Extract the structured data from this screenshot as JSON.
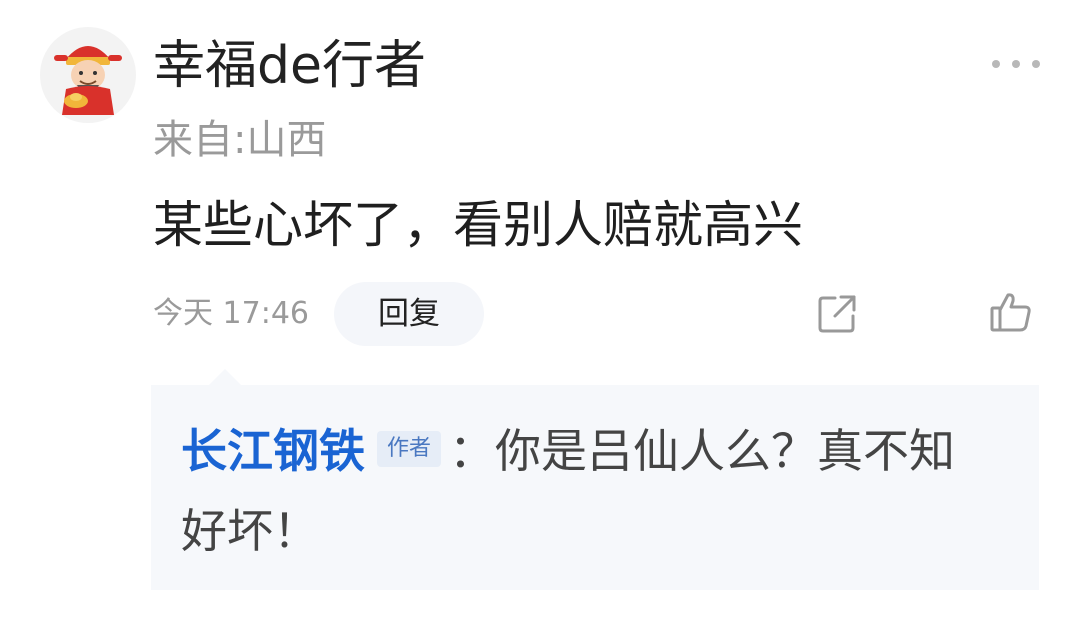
{
  "comment": {
    "avatar_icon": "caishen-avatar-icon",
    "username": "幸福de行者",
    "location": "来自:山西",
    "text": "某些心坏了，看别人赔就高兴",
    "time": "今天 17:46",
    "reply_label": "回复",
    "more_icon": "more-dots-icon",
    "share_icon": "share-icon",
    "like_icon": "thumbs-up-icon"
  },
  "reply": {
    "author": "长江钢铁",
    "badge": "作者",
    "text": "：你是吕仙人么？真不知好坏！"
  },
  "colors": {
    "author_blue": "#1a64d3",
    "badge_bg": "#e6edf7",
    "reply_box_bg": "#f6f8fb",
    "muted_text": "#9a9a9a"
  }
}
